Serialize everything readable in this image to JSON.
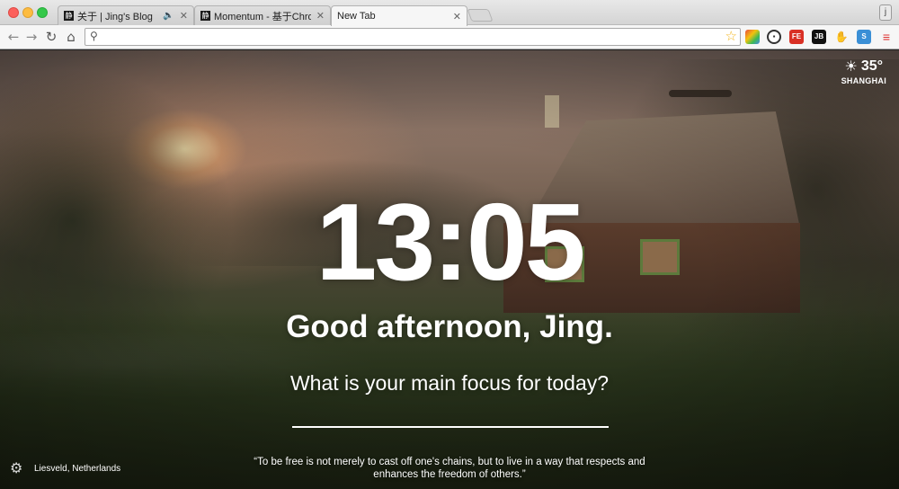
{
  "window": {
    "tabs": [
      {
        "label": "关于 | Jing's Blog",
        "favicon": "静",
        "audio": true
      },
      {
        "label": "Momentum - 基于Chrome的",
        "favicon": "静",
        "audio": false
      },
      {
        "label": "New Tab",
        "favicon": "",
        "audio": false
      }
    ],
    "profile_label": "j"
  },
  "toolbar": {
    "address_value": "",
    "address_placeholder": "",
    "extensions": [
      "folder-extension-icon",
      "lastpass-icon",
      "fe-helper-icon",
      "jetbrains-icon",
      "evernote-icon",
      "s-extension-icon",
      "chrome-menu-icon"
    ]
  },
  "weather": {
    "temperature": "35°",
    "city": "SHANGHAI"
  },
  "clock": {
    "time": "13:05"
  },
  "greeting": {
    "text": "Good afternoon, Jing."
  },
  "focus": {
    "question": "What is your main focus for today?",
    "value": ""
  },
  "footer": {
    "location": "Liesveld, Netherlands",
    "quote": "“To be free is not merely to cast off one's chains, but to live in a way that respects and enhances the freedom of others.”"
  }
}
